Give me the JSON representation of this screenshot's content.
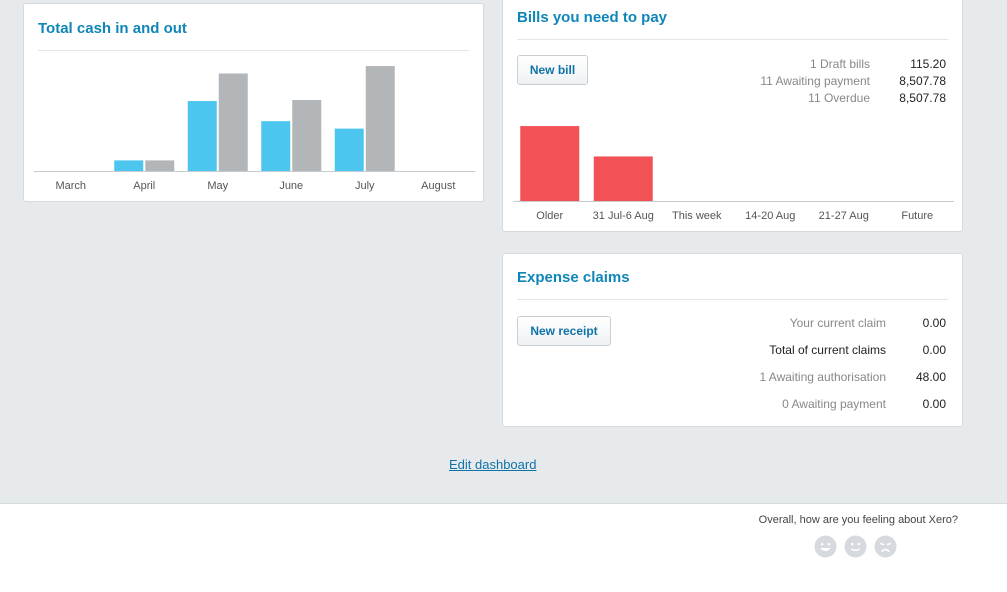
{
  "cash_panel": {
    "title": "Total cash in and out"
  },
  "bills_panel": {
    "title": "Bills you need to pay",
    "new_bill_label": "New bill",
    "stats": [
      {
        "label": "1 Draft bills",
        "value": "115.20"
      },
      {
        "label": "11 Awaiting payment",
        "value": "8,507.78"
      },
      {
        "label": "11 Overdue",
        "value": "8,507.78"
      }
    ]
  },
  "expense_panel": {
    "title": "Expense claims",
    "new_receipt_label": "New receipt",
    "stats": [
      {
        "label": "Your current claim",
        "value": "0.00"
      },
      {
        "label": "Total of current claims",
        "value": "0.00"
      },
      {
        "label": "1 Awaiting authorisation",
        "value": "48.00"
      },
      {
        "label": "0 Awaiting payment",
        "value": "0.00"
      }
    ]
  },
  "edit_dashboard_label": "Edit dashboard",
  "feedback": {
    "question": "Overall, how are you feeling about Xero?",
    "faces": [
      "happy-face-icon",
      "neutral-face-icon",
      "sad-face-icon"
    ]
  },
  "colors": {
    "cash_in": "#4cc6ee",
    "cash_out": "#b3b6b9",
    "bills": "#f25256",
    "title": "#0f86b8",
    "link": "#0f73a8",
    "face": "#d6dade"
  },
  "chart_data": [
    {
      "type": "bar",
      "categories": [
        "March",
        "April",
        "May",
        "June",
        "July",
        "August"
      ],
      "series": [
        {
          "values": [
            0,
            10,
            66,
            47,
            40,
            0
          ]
        },
        {
          "values": [
            0,
            10,
            92,
            67,
            99,
            0
          ]
        }
      ],
      "ylim": [
        0,
        100
      ],
      "grid": false,
      "legend": "none"
    },
    {
      "type": "bar",
      "categories": [
        "Older",
        "31 Jul-6 Aug",
        "This week",
        "14-20 Aug",
        "21-27 Aug",
        "Future"
      ],
      "values": [
        74,
        44,
        0,
        0,
        0,
        0
      ],
      "ylim": [
        0,
        80
      ],
      "grid": false,
      "legend": "none"
    }
  ]
}
